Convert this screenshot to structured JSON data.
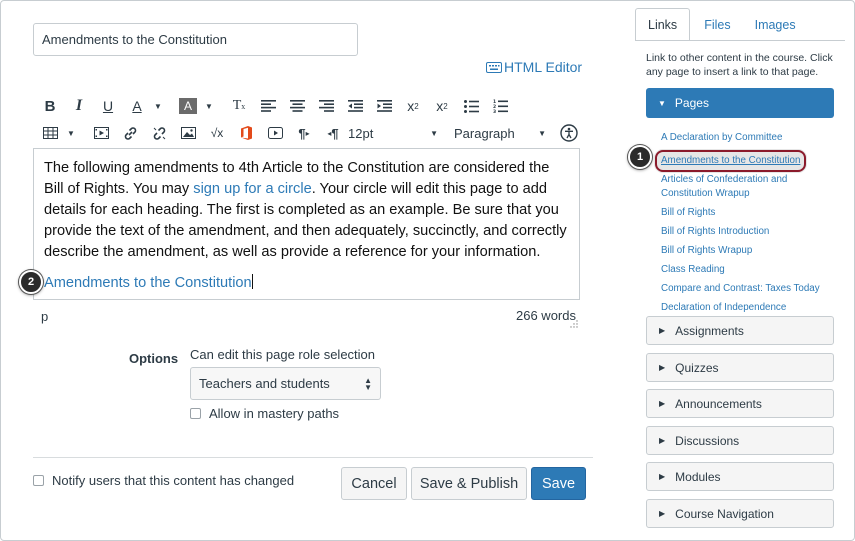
{
  "editor": {
    "title_value": "Amendments to the Constitution",
    "html_editor_label": "HTML Editor",
    "font_size": "12pt",
    "block_format": "Paragraph",
    "body_text_before_link": "The following amendments to 4th Article to the Constitution are considered the Bill of Rights. You may ",
    "body_link_text": "sign up for a circle",
    "body_text_after_link": ". Your circle will edit this page to add details for each heading. The first is completed as an example. Be sure that you provide the text of the amendment, and then adequately, succinctly, and correctly describe the amendment, as well as provide a reference for your information.",
    "heading_text": "Amendments to the Constitution",
    "status_path": "p",
    "word_count": "266 words"
  },
  "toolbar": {
    "bold": "B",
    "italic": "I",
    "underline": "U",
    "font_color": "A",
    "bg_color": "A",
    "clear_format": "T",
    "superscript": "x",
    "superscript_mark": "2",
    "subscript": "x",
    "subscript_mark": "2"
  },
  "options": {
    "label": "Options",
    "description": "Can edit this page role selection",
    "role_selected": "Teachers and students",
    "mastery_label": "Allow in mastery paths",
    "notify_label": "Notify users that this content has changed"
  },
  "buttons": {
    "cancel": "Cancel",
    "save_publish": "Save & Publish",
    "save": "Save"
  },
  "badges": {
    "one": "1",
    "two": "2"
  },
  "sidebar": {
    "tabs": [
      "Links",
      "Files",
      "Images"
    ],
    "help_text": "Link to other content in the course. Click any page to insert a link to that page.",
    "pages_header": "Pages",
    "pages": [
      "A Declaration by Committee",
      "Amendments to the Constitution",
      "Articles of Confederation and Constitution Wrapup",
      "Bill of Rights",
      "Bill of Rights Introduction",
      "Bill of Rights Wrapup",
      "Class Reading",
      "Compare and Contrast: Taxes Today",
      "Declaration of Independence"
    ],
    "sections": [
      "Assignments",
      "Quizzes",
      "Announcements",
      "Discussions",
      "Modules",
      "Course Navigation"
    ]
  },
  "colors": {
    "accent": "#2d7ab6",
    "highlight_outline": "#8b1a2b",
    "text": "#2d3b45"
  }
}
